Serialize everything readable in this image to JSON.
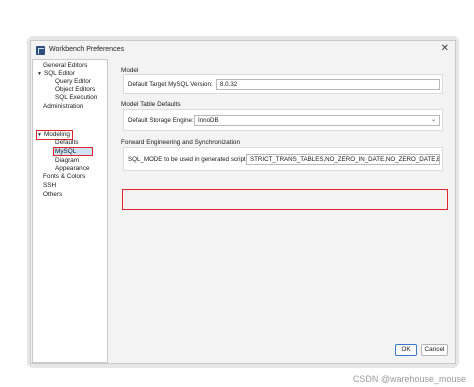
{
  "window": {
    "title": "Workbench Preferences",
    "close_glyph": "✕"
  },
  "sidebar": {
    "items": [
      {
        "label": "General Editors",
        "indent": 0
      },
      {
        "label": "SQL Editor",
        "indent": 0,
        "expanded": true
      },
      {
        "label": "Query Editor",
        "indent": 2
      },
      {
        "label": "Object Editors",
        "indent": 2
      },
      {
        "label": "SQL Execution",
        "indent": 2
      },
      {
        "label": "Administration",
        "indent": 0
      },
      {
        "label": "Modeling",
        "indent": 0,
        "expanded": true,
        "highlighted": true
      },
      {
        "label": "Defaults",
        "indent": 1
      },
      {
        "label": "MySQL",
        "indent": 1,
        "selected": true,
        "highlighted": true
      },
      {
        "label": "Diagram",
        "indent": 1
      },
      {
        "label": "Appearance",
        "indent": 1
      },
      {
        "label": "Fonts & Colors",
        "indent": 0
      },
      {
        "label": "SSH",
        "indent": 0
      },
      {
        "label": "Others",
        "indent": 0
      }
    ],
    "caret_glyph": "▼"
  },
  "model": {
    "section_title": "Model",
    "target_label": "Default Target MySQL Version:",
    "target_value": "8.0.32"
  },
  "model_table": {
    "section_title": "Model Table Defaults",
    "engine_label": "Default Storage Engine:",
    "engine_value": "InnoDB",
    "arrow_glyph": "⌄"
  },
  "forward": {
    "section_title": "Forward Engineering and Synchronization",
    "sql_mode_label": "SQL_MODE to be used in generated scripts:",
    "sql_mode_value": "STRICT_TRANS_TABLES,NO_ZERO_IN_DATE,NO_ZERO_DATE,ERROR_FC"
  },
  "buttons": {
    "ok": "OK",
    "cancel": "Cancel"
  },
  "watermark": "CSDN @warehouse_mouse",
  "colors": {
    "highlight_red": "#e0242c",
    "selection_blue": "#cfe3f7",
    "primary_border": "#3a78c9"
  }
}
